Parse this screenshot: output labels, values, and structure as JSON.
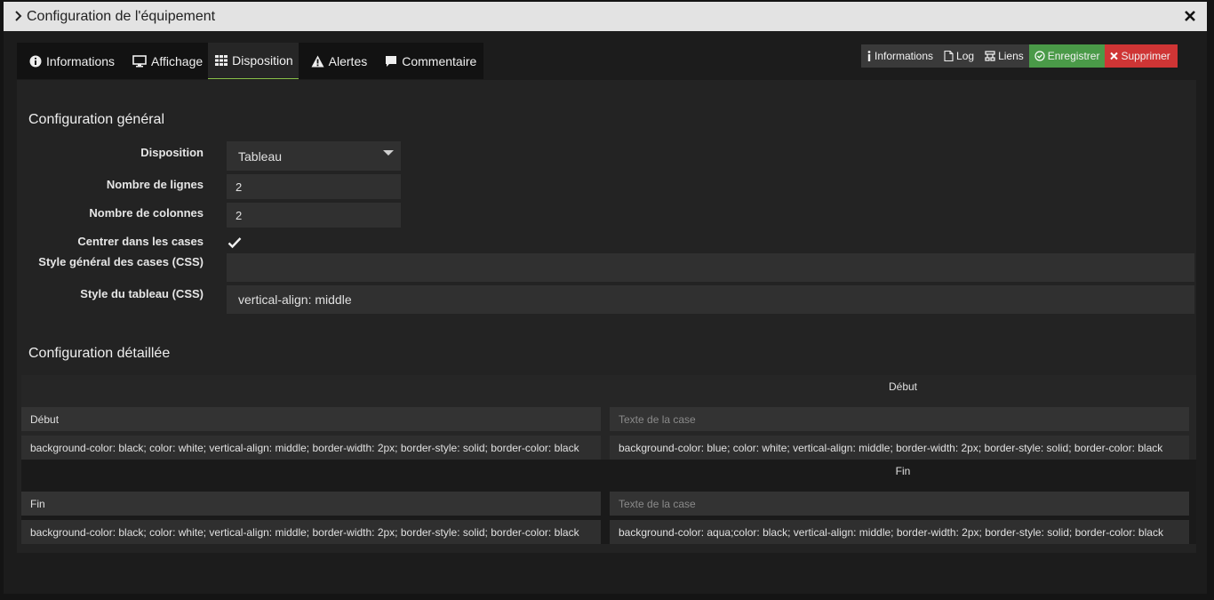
{
  "dialog": {
    "title": "Configuration de l'équipement"
  },
  "tabs": [
    {
      "label": "Informations",
      "icon": "info-circle-icon"
    },
    {
      "label": "Affichage",
      "icon": "monitor-icon"
    },
    {
      "label": "Disposition",
      "icon": "grid-icon",
      "active": true
    },
    {
      "label": "Alertes",
      "icon": "warning-icon"
    },
    {
      "label": "Commentaire",
      "icon": "comment-icon"
    }
  ],
  "actions": [
    {
      "label": "Informations",
      "icon": "info-icon"
    },
    {
      "label": "Log",
      "icon": "file-icon"
    },
    {
      "label": "Liens",
      "icon": "sitemap-icon"
    },
    {
      "label": "Enregistrer",
      "icon": "check-circle-icon",
      "color": "#4a9a48"
    },
    {
      "label": "Supprimer",
      "icon": "times-icon",
      "color": "#cf3535"
    }
  ],
  "general": {
    "heading": "Configuration général",
    "disposition_label": "Disposition",
    "disposition_value": "Tableau",
    "lines_label": "Nombre de lignes",
    "lines_value": "2",
    "cols_label": "Nombre de colonnes",
    "cols_value": "2",
    "center_label": "Centrer dans les cases",
    "center_checked": true,
    "cell_style_label": "Style général des cases (CSS)",
    "cell_style_value": "",
    "table_style_label": "Style du tableau (CSS)",
    "table_style_value": "vertical-align: middle"
  },
  "detailed": {
    "heading": "Configuration détaillée",
    "rows": [
      {
        "header": "Début",
        "cells": [
          {
            "text": "Début",
            "placeholder": "Texte de la case",
            "css": "background-color: black; color: white; vertical-align: middle; border-width: 2px; border-style: solid; border-color: black"
          },
          {
            "text": "",
            "placeholder": "Texte de la case",
            "css": "background-color: blue; color: white; vertical-align: middle; border-width: 2px; border-style: solid; border-color: black"
          }
        ]
      },
      {
        "header": "Fin",
        "cells": [
          {
            "text": "Fin",
            "placeholder": "Texte de la case",
            "css": "background-color: black; color: white; vertical-align: middle; border-width: 2px; border-style: solid; border-color: black"
          },
          {
            "text": "",
            "placeholder": "Texte de la case",
            "css": "background-color: aqua;color: black; vertical-align: middle; border-width: 2px; border-style: solid; border-color: black"
          }
        ]
      }
    ]
  }
}
